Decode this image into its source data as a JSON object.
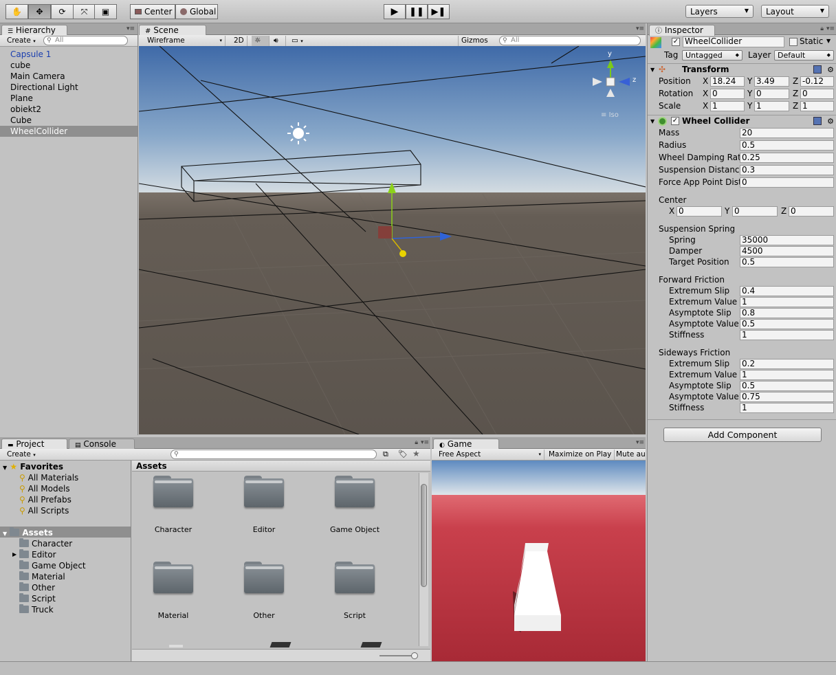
{
  "toolbar": {
    "pivot_label": "Center",
    "space_label": "Global",
    "layers_label": "Layers",
    "layout_label": "Layout",
    "tools": [
      "hand-icon",
      "move-icon",
      "rotate-icon",
      "scale-icon",
      "rect-icon"
    ]
  },
  "hierarchy": {
    "tab": "Hierarchy",
    "create": "Create",
    "search_placeholder": "All",
    "items": [
      {
        "label": "Capsule 1",
        "prefab": true
      },
      {
        "label": "cube"
      },
      {
        "label": "Main Camera"
      },
      {
        "label": "Directional Light"
      },
      {
        "label": "Plane"
      },
      {
        "label": "obiekt2"
      },
      {
        "label": "Cube"
      },
      {
        "label": "WheelCollider",
        "selected": true
      }
    ]
  },
  "scene": {
    "tab": "Scene",
    "shading_mode": "Wireframe",
    "mode_2d": "2D",
    "gizmos": "Gizmos",
    "search_placeholder": "All",
    "gizmo_labels": {
      "y": "y",
      "z": "z",
      "projection": "Iso"
    }
  },
  "inspector": {
    "tab": "Inspector",
    "object_name": "WheelCollider",
    "static_label": "Static",
    "tag_label": "Tag",
    "tag_value": "Untagged",
    "layer_label": "Layer",
    "layer_value": "Default",
    "transform": {
      "title": "Transform",
      "position_label": "Position",
      "rotation_label": "Rotation",
      "scale_label": "Scale",
      "position": {
        "x": "18.24",
        "y": "3.49",
        "z": "-0.12"
      },
      "rotation": {
        "x": "0",
        "y": "0",
        "z": "0"
      },
      "scale": {
        "x": "1",
        "y": "1",
        "z": "1"
      },
      "axis_x": "X",
      "axis_y": "Y",
      "axis_z": "Z"
    },
    "wheel_collider": {
      "title": "Wheel Collider",
      "mass_label": "Mass",
      "mass": "20",
      "radius_label": "Radius",
      "radius": "0.5",
      "damping_label": "Wheel Damping Rate",
      "damping": "0.25",
      "suspension_distance_label": "Suspension Distance",
      "suspension_distance": "0.3",
      "force_app_label": "Force App Point Dista",
      "force_app": "0",
      "center_label": "Center",
      "center": {
        "x": "0",
        "y": "0",
        "z": "0"
      },
      "suspension_spring_label": "Suspension Spring",
      "spring_label": "Spring",
      "spring": "35000",
      "damper_label": "Damper",
      "damper": "4500",
      "target_label": "Target Position",
      "target": "0.5",
      "forward_label": "Forward Friction",
      "forward": {
        "ext_slip": "0.4",
        "ext_value": "1",
        "asym_slip": "0.8",
        "asym_value": "0.5",
        "stiffness": "1"
      },
      "sideways_label": "Sideways Friction",
      "sideways": {
        "ext_slip": "0.2",
        "ext_value": "1",
        "asym_slip": "0.5",
        "asym_value": "0.75",
        "stiffness": "1"
      },
      "ext_slip_label": "Extremum Slip",
      "ext_value_label": "Extremum Value",
      "asym_slip_label": "Asymptote Slip",
      "asym_value_label": "Asymptote Value",
      "stiffness_label": "Stiffness"
    },
    "add_component": "Add Component"
  },
  "project": {
    "tab_project": "Project",
    "tab_console": "Console",
    "create": "Create",
    "favorites_label": "Favorites",
    "favorites": [
      "All Materials",
      "All Models",
      "All Prefabs",
      "All Scripts"
    ],
    "assets_label": "Assets",
    "assets_tree": [
      "Character",
      "Editor",
      "Game Object",
      "Material",
      "Other",
      "Script",
      "Truck"
    ],
    "grid_header": "Assets",
    "grid_items": [
      "Character",
      "Editor",
      "Game Object",
      "Material",
      "Other",
      "Script"
    ]
  },
  "game": {
    "tab": "Game",
    "aspect": "Free Aspect",
    "maximize": "Maximize on Play",
    "mute": "Mute au"
  },
  "colors": {
    "panel_bg": "#c2c2c2",
    "selection": "#8f8f8f",
    "prefab_text": "#1a3eaf",
    "game_floor": "#b4303c",
    "scene_ground": "#625b52"
  }
}
